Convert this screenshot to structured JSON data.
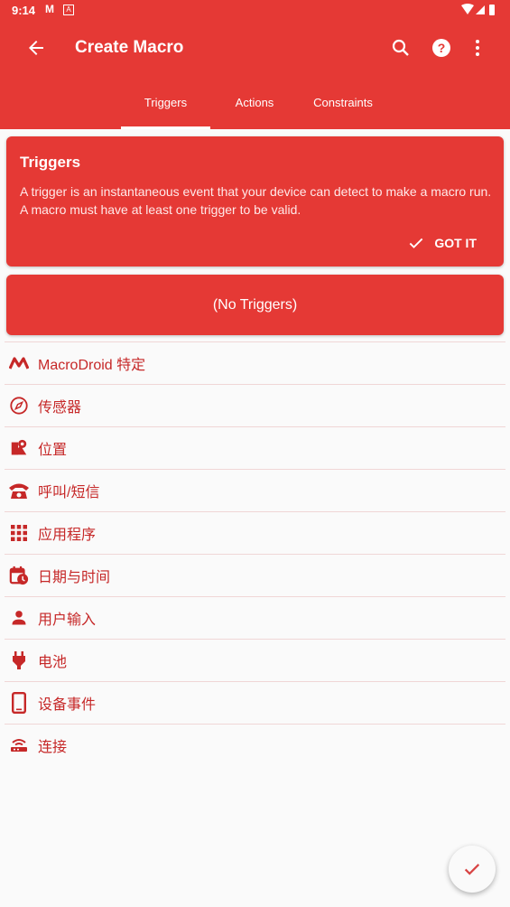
{
  "status_bar": {
    "time": "9:14",
    "app_icon_1": "M",
    "app_icon_2": "A"
  },
  "toolbar": {
    "title": "Create Macro",
    "back_icon": "arrow-left",
    "search_icon": "search",
    "help_icon": "help-circle",
    "more_icon": "more-vert"
  },
  "tabs": [
    {
      "label": "Triggers",
      "active": true
    },
    {
      "label": "Actions",
      "active": false
    },
    {
      "label": "Constraints",
      "active": false
    }
  ],
  "info_card": {
    "title": "Triggers",
    "body": "A trigger is an instantaneous event that your device can detect to make a macro run. A macro must have at least one trigger to be valid.",
    "button_label": "GOT IT"
  },
  "empty_card": {
    "label": "(No Triggers)"
  },
  "categories": [
    {
      "label": "MacroDroid 特定",
      "icon": "macrodroid"
    },
    {
      "label": "传感器",
      "icon": "compass"
    },
    {
      "label": "位置",
      "icon": "map-pin"
    },
    {
      "label": "呼叫/短信",
      "icon": "phone"
    },
    {
      "label": "应用程序",
      "icon": "apps-grid"
    },
    {
      "label": "日期与时间",
      "icon": "calendar-clock"
    },
    {
      "label": "用户输入",
      "icon": "person"
    },
    {
      "label": "电池",
      "icon": "plug"
    },
    {
      "label": "设备事件",
      "icon": "smartphone"
    },
    {
      "label": "连接",
      "icon": "router"
    }
  ],
  "colors": {
    "primary": "#e53935",
    "list_text": "#c62828",
    "background": "#fafafa"
  }
}
